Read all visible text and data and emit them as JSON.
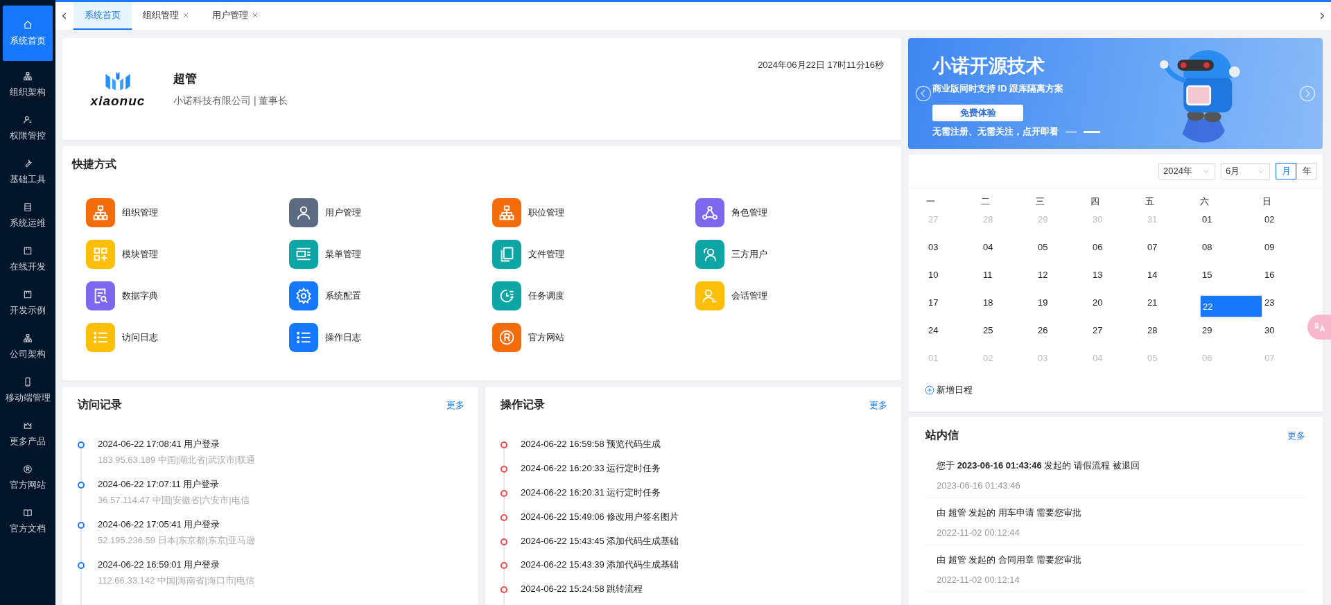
{
  "sidebar": {
    "items": [
      {
        "label": "系统首页",
        "selected": true
      },
      {
        "label": "组织架构",
        "selected": false
      },
      {
        "label": "权限管控",
        "selected": false
      },
      {
        "label": "基础工具",
        "selected": false
      },
      {
        "label": "系统运维",
        "selected": false
      },
      {
        "label": "在线开发",
        "selected": false
      },
      {
        "label": "开发示例",
        "selected": false
      },
      {
        "label": "公司架构",
        "selected": false
      },
      {
        "label": "移动端管理",
        "selected": false
      },
      {
        "label": "更多产品",
        "selected": false
      },
      {
        "label": "官方网站",
        "selected": false
      },
      {
        "label": "官方文档",
        "selected": false
      }
    ]
  },
  "tabs": [
    {
      "label": "系统首页",
      "selected": true,
      "closable": false
    },
    {
      "label": "组织管理",
      "selected": false,
      "closable": true
    },
    {
      "label": "用户管理",
      "selected": false,
      "closable": true
    }
  ],
  "profile": {
    "logo_text": "xiaonuc",
    "name": "超管",
    "org": "小诺科技有限公司 | 董事长",
    "datetime": "2024年06月22日 17时11分16秒"
  },
  "shortcuts": {
    "title": "快捷方式",
    "items": [
      {
        "label": "组织管理",
        "color": "#f56c0a"
      },
      {
        "label": "用户管理",
        "color": "#5b6b82"
      },
      {
        "label": "职位管理",
        "color": "#f56c0a"
      },
      {
        "label": "角色管理",
        "color": "#7b68ee"
      },
      {
        "label": "模块管理",
        "color": "#fbbf09"
      },
      {
        "label": "菜单管理",
        "color": "#0ea5a5"
      },
      {
        "label": "文件管理",
        "color": "#0ea5a5"
      },
      {
        "label": "三方用户",
        "color": "#0ea5a5"
      },
      {
        "label": "数据字典",
        "color": "#7b68ee"
      },
      {
        "label": "系统配置",
        "color": "#1677ff"
      },
      {
        "label": "任务调度",
        "color": "#0ea5a5"
      },
      {
        "label": "会话管理",
        "color": "#fbbf09"
      },
      {
        "label": "访问日志",
        "color": "#fbbf09"
      },
      {
        "label": "操作日志",
        "color": "#1677ff"
      },
      {
        "label": "官方网站",
        "color": "#f56c0a"
      }
    ]
  },
  "visit_log": {
    "title": "访问记录",
    "more": "更多",
    "items": [
      {
        "time": "2024-06-22 17:08:41 用户登录",
        "detail": "183.95.63.189 中国|湖北省|武汉市|联通"
      },
      {
        "time": "2024-06-22 17:07:11 用户登录",
        "detail": "36.57.114.47 中国|安徽省|六安市|电信"
      },
      {
        "time": "2024-06-22 17:05:41 用户登录",
        "detail": "52.195.236.59 日本|东京都|东京|亚马逊"
      },
      {
        "time": "2024-06-22 16:59:01 用户登录",
        "detail": "112.66.33.142 中国|海南省|海口市|电信"
      }
    ]
  },
  "operation_log": {
    "title": "操作记录",
    "more": "更多",
    "items": [
      "2024-06-22 16:59:58 预览代码生成",
      "2024-06-22 16:20:33 运行定时任务",
      "2024-06-22 16:20:31 运行定时任务",
      "2024-06-22 15:49:06 修改用户签名图片",
      "2024-06-22 15:43:45 添加代码生成基础",
      "2024-06-22 15:43:39 添加代码生成基础",
      "2024-06-22 15:24:58 跳转流程"
    ]
  },
  "banner": {
    "title": "小诺开源技术",
    "subtitle": "商业版同时支持 ID 跟库隔离方案",
    "button": "免费体验",
    "tagline": "无需注册、无需关注，点开即看",
    "indicators": [
      {
        "selected": false
      },
      {
        "selected": true
      }
    ]
  },
  "calendar": {
    "year": "2024年",
    "month": "6月",
    "views": [
      {
        "label": "月",
        "selected": true
      },
      {
        "label": "年",
        "selected": false
      }
    ],
    "weekdays": [
      "一",
      "二",
      "三",
      "四",
      "五",
      "六",
      "日"
    ],
    "weeks": [
      [
        {
          "day": "27",
          "outside": true,
          "selected": false
        },
        {
          "day": "28",
          "outside": true,
          "selected": false
        },
        {
          "day": "29",
          "outside": true,
          "selected": false
        },
        {
          "day": "30",
          "outside": true,
          "selected": false
        },
        {
          "day": "31",
          "outside": true,
          "selected": false
        },
        {
          "day": "01",
          "outside": false,
          "selected": false
        },
        {
          "day": "02",
          "outside": false,
          "selected": false
        }
      ],
      [
        {
          "day": "03",
          "outside": false,
          "selected": false
        },
        {
          "day": "04",
          "outside": false,
          "selected": false
        },
        {
          "day": "05",
          "outside": false,
          "selected": false
        },
        {
          "day": "06",
          "outside": false,
          "selected": false
        },
        {
          "day": "07",
          "outside": false,
          "selected": false
        },
        {
          "day": "08",
          "outside": false,
          "selected": false
        },
        {
          "day": "09",
          "outside": false,
          "selected": false
        }
      ],
      [
        {
          "day": "10",
          "outside": false,
          "selected": false
        },
        {
          "day": "11",
          "outside": false,
          "selected": false
        },
        {
          "day": "12",
          "outside": false,
          "selected": false
        },
        {
          "day": "13",
          "outside": false,
          "selected": false
        },
        {
          "day": "14",
          "outside": false,
          "selected": false
        },
        {
          "day": "15",
          "outside": false,
          "selected": false
        },
        {
          "day": "16",
          "outside": false,
          "selected": false
        }
      ],
      [
        {
          "day": "17",
          "outside": false,
          "selected": false
        },
        {
          "day": "18",
          "outside": false,
          "selected": false
        },
        {
          "day": "19",
          "outside": false,
          "selected": false
        },
        {
          "day": "20",
          "outside": false,
          "selected": false
        },
        {
          "day": "21",
          "outside": false,
          "selected": false
        },
        {
          "day": "22",
          "outside": false,
          "selected": true
        },
        {
          "day": "23",
          "outside": false,
          "selected": false
        }
      ],
      [
        {
          "day": "24",
          "outside": false,
          "selected": false
        },
        {
          "day": "25",
          "outside": false,
          "selected": false
        },
        {
          "day": "26",
          "outside": false,
          "selected": false
        },
        {
          "day": "27",
          "outside": false,
          "selected": false
        },
        {
          "day": "28",
          "outside": false,
          "selected": false
        },
        {
          "day": "29",
          "outside": false,
          "selected": false
        },
        {
          "day": "30",
          "outside": false,
          "selected": false
        }
      ],
      [
        {
          "day": "01",
          "outside": true,
          "selected": false
        },
        {
          "day": "02",
          "outside": true,
          "selected": false
        },
        {
          "day": "03",
          "outside": true,
          "selected": false
        },
        {
          "day": "04",
          "outside": true,
          "selected": false
        },
        {
          "day": "05",
          "outside": true,
          "selected": false
        },
        {
          "day": "06",
          "outside": true,
          "selected": false
        },
        {
          "day": "07",
          "outside": true,
          "selected": false
        }
      ]
    ],
    "add_event": "新增日程"
  },
  "messages": {
    "title": "站内信",
    "more": "更多",
    "items": [
      {
        "text": "您于 **2023-06-16 01:43:46** 发起的 请假流程 被退回",
        "time": "2023-06-16 01:43:46"
      },
      {
        "text": "由 超管 发起的 用车申请 需要您审批",
        "time": "2022-11-02 00:12:44"
      },
      {
        "text": "由 超管 发起的 合同用章 需要您审批",
        "time": "2022-11-02 00:12:14"
      }
    ]
  }
}
